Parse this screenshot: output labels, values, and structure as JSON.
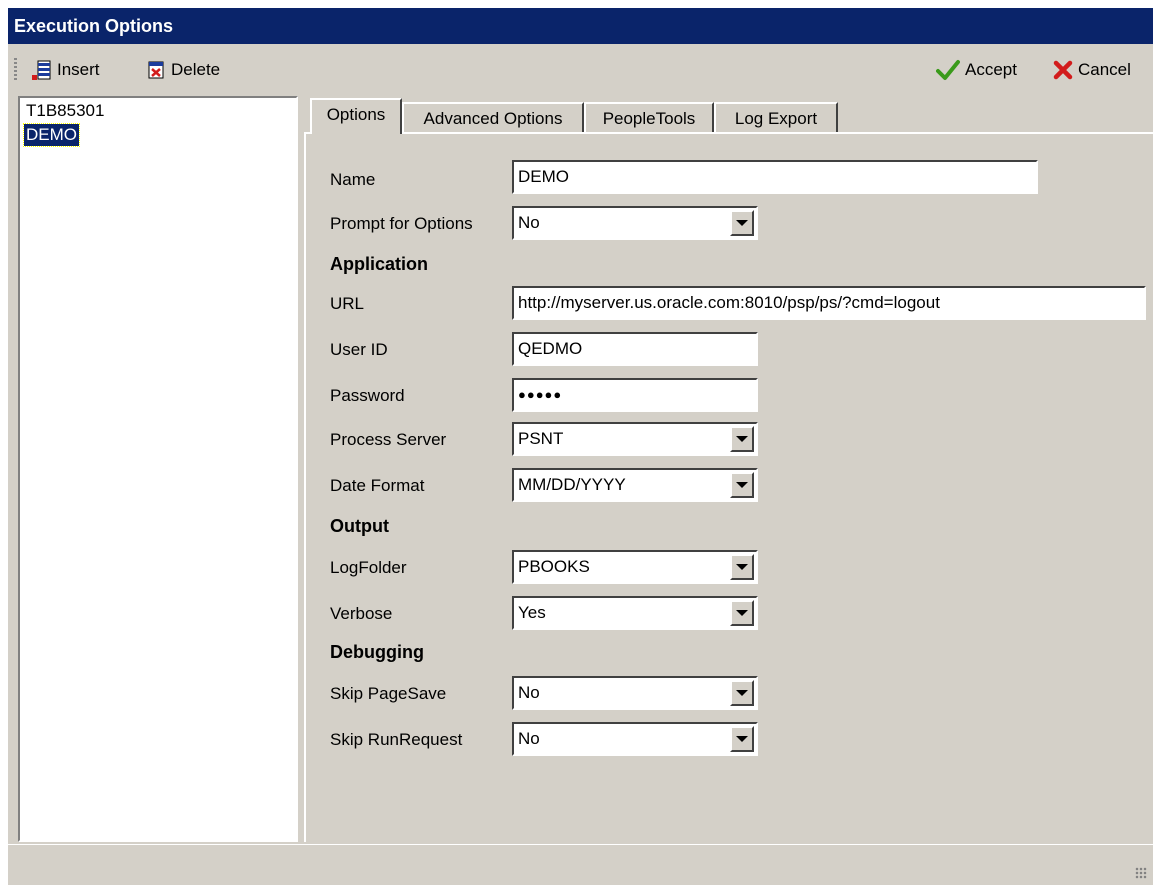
{
  "window": {
    "title": "Execution Options"
  },
  "toolbar": {
    "insert_label": "Insert",
    "delete_label": "Delete",
    "accept_label": "Accept",
    "cancel_label": "Cancel"
  },
  "list": {
    "items": [
      "T1B85301",
      "DEMO"
    ],
    "selected": "DEMO"
  },
  "tabs": [
    "Options",
    "Advanced Options",
    "PeopleTools",
    "Log Export"
  ],
  "form": {
    "name_label": "Name",
    "name_value": "DEMO",
    "prompt_label": "Prompt for Options",
    "prompt_value": "No",
    "application_heading": "Application",
    "url_label": "URL",
    "url_value": "http://myserver.us.oracle.com:8010/psp/ps/?cmd=logout",
    "userid_label": "User ID",
    "userid_value": "QEDMO",
    "password_label": "Password",
    "password_value": "●●●●●",
    "process_server_label": "Process Server",
    "process_server_value": "PSNT",
    "date_format_label": "Date Format",
    "date_format_value": "MM/DD/YYYY",
    "output_heading": "Output",
    "logfolder_label": "LogFolder",
    "logfolder_value": "PBOOKS",
    "verbose_label": "Verbose",
    "verbose_value": "Yes",
    "debugging_heading": "Debugging",
    "skip_pagesave_label": "Skip PageSave",
    "skip_pagesave_value": "No",
    "skip_runrequest_label": "Skip RunRequest",
    "skip_runrequest_value": "No"
  },
  "colors": {
    "title_bg": "#0a246a",
    "face": "#d4d0c8",
    "accept_green": "#3a9a1a",
    "cancel_red": "#d21c1c"
  }
}
